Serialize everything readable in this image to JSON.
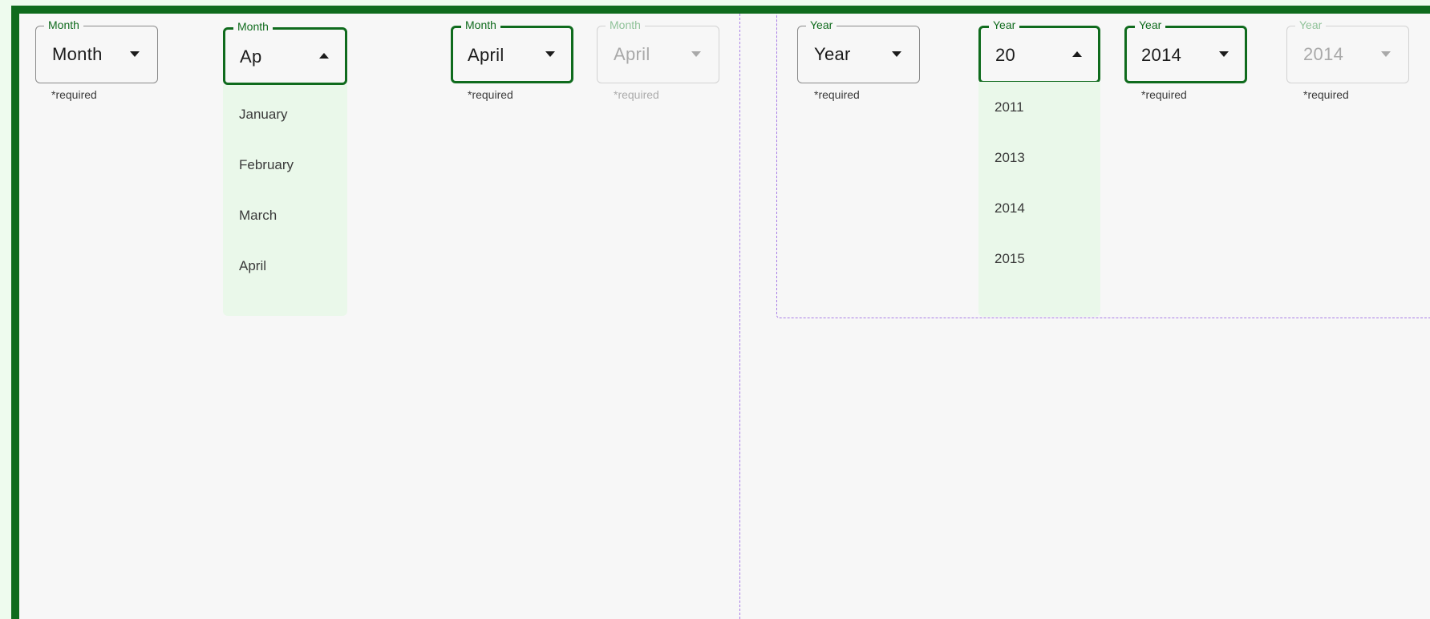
{
  "month_fields": [
    {
      "label": "Month",
      "value": "Month",
      "helper": "*required"
    },
    {
      "label": "Month",
      "value": "Ap"
    },
    {
      "label": "Month",
      "value": "April",
      "helper": "*required"
    },
    {
      "label": "Month",
      "value": "April",
      "helper": "*required"
    }
  ],
  "month_menu": [
    "January",
    "February",
    "March",
    "April"
  ],
  "year_fields": [
    {
      "label": "Year",
      "value": "Year",
      "helper": "*required"
    },
    {
      "label": "Year",
      "value": "20"
    },
    {
      "label": "Year",
      "value": "2014",
      "helper": "*required"
    },
    {
      "label": "Year",
      "value": "2014",
      "helper": "*required"
    }
  ],
  "year_menu": [
    "2011",
    "2013",
    "2014",
    "2015"
  ],
  "colors": {
    "accent": "#0f6b1d",
    "menu_bg": "#eaf8ea",
    "divider": "#a97ee6",
    "outer_bg": "#eefbee"
  }
}
